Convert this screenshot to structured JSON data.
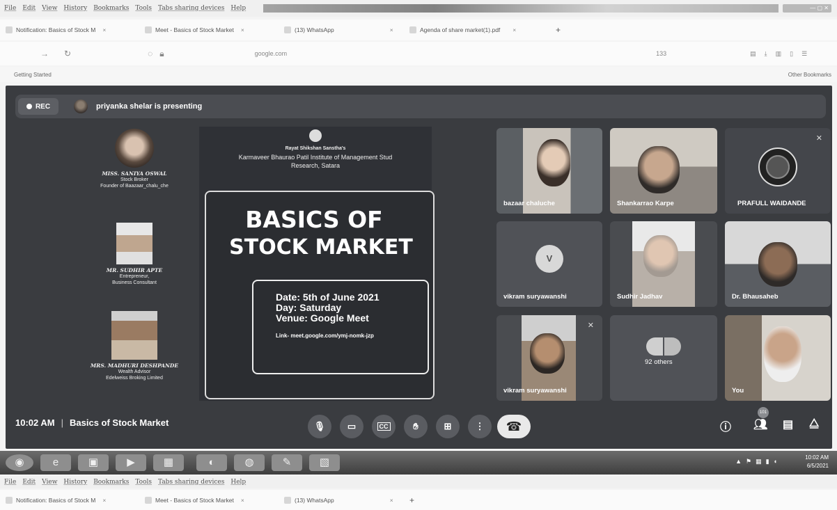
{
  "browser": {
    "menu": [
      "File",
      "Edit",
      "View",
      "History",
      "Bookmarks",
      "Tools",
      "Tabs sharing devices",
      "Help"
    ],
    "tabs": [
      {
        "label": "Notification: Basics of Stock M",
        "close": "×"
      },
      {
        "label": "Meet - Basics of Stock Market",
        "close": "×"
      },
      {
        "label": "(13) WhatsApp",
        "close": "×"
      },
      {
        "label": "Agenda of share market(1).pdf",
        "close": "×"
      }
    ],
    "new_tab": "+",
    "address": "google.com",
    "zoom": "133",
    "bookmarks_left": "Getting Started",
    "bookmarks_right": "Other Bookmarks"
  },
  "meet": {
    "rec_label": "REC",
    "presenting_text": "priyanka shelar is presenting",
    "clock": "10:02 AM",
    "meeting_title": "Basics of Stock Market",
    "participants_badge": "101",
    "tiles": [
      {
        "label": "bazaar chaluche"
      },
      {
        "label": "Shankarrao Karpe"
      },
      {
        "label": "PRAFULL WAIDANDE",
        "initial_icon": "network-avatar-icon"
      },
      {
        "label": "vikram suryawanshi",
        "initial": "V"
      },
      {
        "label": "Sudhir Jadhav"
      },
      {
        "label": "Dr. Bhausaheb"
      },
      {
        "label": "vikram suryawanshi"
      },
      {
        "label": "92 others"
      },
      {
        "label": "You"
      }
    ]
  },
  "slide": {
    "org_line1": "Rayat Shikshan Sanstha's",
    "org_line2": "Karmaveer Bhaurao Patil Institute of Management Stud",
    "org_line3": "Research, Satara",
    "title_line1": "BASICS OF",
    "title_line2": "STOCK MARKET",
    "date": "Date: 5th of June 2021",
    "day": "Day: Saturday",
    "venue": "Venue: Google Meet",
    "link": "Link- meet.google.com/ymj-nomk-jzp",
    "speakers": [
      {
        "name": "MISS. SANIYA OSWAL",
        "role1": "Stock Broker",
        "role2": "Founder of Baazaar_chalu_che"
      },
      {
        "name": "MR. SUDHIR APTE",
        "role1": "Entrepreneur,",
        "role2": "Business Consultant"
      },
      {
        "name": "MRS. MADHURI DESHPANDE",
        "role1": "Wealth Advisor",
        "role2": "Edelweiss Broking Limited"
      }
    ]
  },
  "taskbar": {
    "time": "10:02 AM",
    "date": "6/5/2021"
  },
  "colors": {
    "meet_bg": "#3a3c40",
    "tile_bg": "#4a4c50",
    "end_call": "#e9e9e9"
  }
}
